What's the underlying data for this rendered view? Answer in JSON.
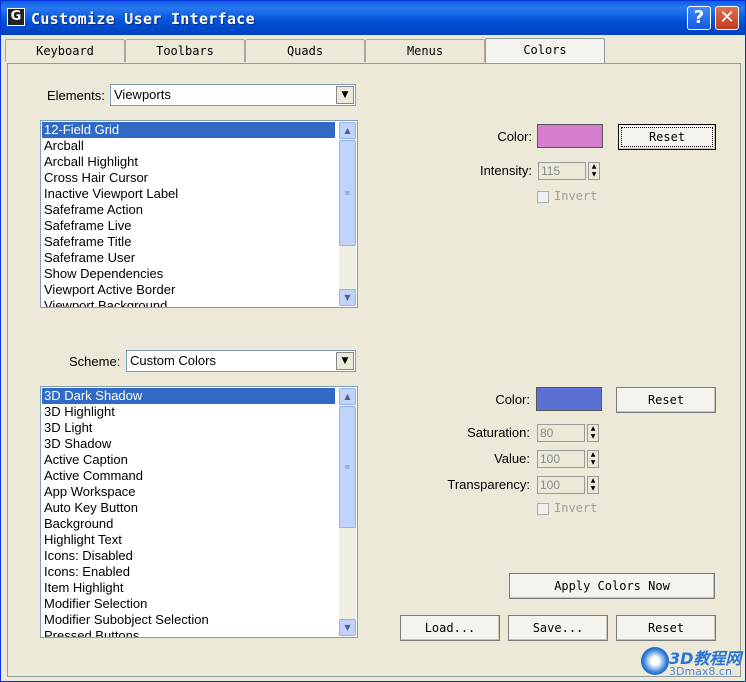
{
  "window": {
    "title": "Customize User Interface",
    "help_glyph": "?",
    "close_glyph": "✕"
  },
  "tabs": [
    {
      "label": "Keyboard",
      "active": false
    },
    {
      "label": "Toolbars",
      "active": false
    },
    {
      "label": "Quads",
      "active": false
    },
    {
      "label": "Menus",
      "active": false
    },
    {
      "label": "Colors",
      "active": true
    }
  ],
  "elements_section": {
    "label": "Elements:",
    "selected": "Viewports",
    "items": [
      "12-Field Grid",
      "Arcball",
      "Arcball Highlight",
      "Cross Hair Cursor",
      "Inactive Viewport Label",
      "Safeframe Action",
      "Safeframe Live",
      "Safeframe Title",
      "Safeframe User",
      "Show Dependencies",
      "Viewport Active Border",
      "Viewport Background"
    ],
    "selected_item": "12-Field Grid",
    "color_label": "Color:",
    "color_value": "#d57ecf",
    "reset_label": "Reset",
    "intensity_label": "Intensity:",
    "intensity_value": "115",
    "invert_label": "Invert"
  },
  "scheme_section": {
    "label": "Scheme:",
    "selected": "Custom Colors",
    "items": [
      "3D Dark Shadow",
      "3D Highlight",
      "3D Light",
      "3D Shadow",
      "Active Caption",
      "Active Command",
      "App Workspace",
      "Auto Key Button",
      "Background",
      "Highlight Text",
      "Icons: Disabled",
      "Icons: Enabled",
      "Item Highlight",
      "Modifier Selection",
      "Modifier Subobject Selection",
      "Pressed Buttons"
    ],
    "selected_item": "3D Dark Shadow",
    "color_label": "Color:",
    "color_value": "#5c6fd3",
    "reset_label": "Reset",
    "saturation_label": "Saturation:",
    "saturation_value": "80",
    "value_label": "Value:",
    "value_value": "100",
    "transparency_label": "Transparency:",
    "transparency_value": "100",
    "invert_label": "Invert"
  },
  "bottom_buttons": {
    "apply": "Apply Colors Now",
    "load": "Load...",
    "save": "Save...",
    "reset": "Reset"
  },
  "watermark": {
    "line1": "3D教程网",
    "line2": "3Dmax8.cn"
  }
}
